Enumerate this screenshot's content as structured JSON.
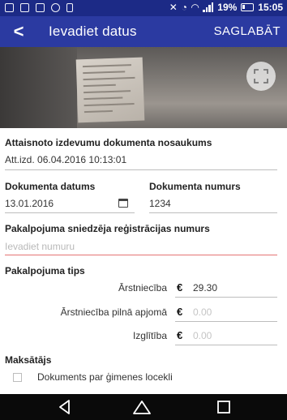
{
  "status_bar": {
    "battery_percent": "19%",
    "time": "15:05",
    "icons": [
      "notification-icon",
      "image-icon",
      "mail-icon",
      "call-icon",
      "lock-icon",
      "mute-icon",
      "alarm-icon",
      "wifi-icon",
      "signal-icon",
      "battery-icon"
    ]
  },
  "app_bar": {
    "title": "Ievadiet datus",
    "save_label": "SAGLABĀT",
    "back_icon": "back-arrow-icon",
    "color": "#2b3aa1"
  },
  "photo": {
    "expand_icon": "fullscreen-icon"
  },
  "form": {
    "doc_name": {
      "label": "Attaisnoto izdevumu dokumenta nosaukums",
      "value": "Att.izd. 06.04.2016 10:13:01"
    },
    "doc_date": {
      "label": "Dokumenta datums",
      "value": "13.01.2016",
      "icon": "calendar-icon"
    },
    "doc_number": {
      "label": "Dokumenta numurs",
      "value": "1234"
    },
    "provider_reg": {
      "label": "Pakalpojuma sniedzēja reģistrācijas numurs",
      "placeholder": "Ievadiet numuru"
    },
    "service_type": {
      "label": "Pakalpojuma tips",
      "currency": "€",
      "rows": [
        {
          "label": "Ārstniecība",
          "value": "29.30"
        },
        {
          "label": "Ārstniecība pilnā apjomā",
          "value": "0.00"
        },
        {
          "label": "Izglītība",
          "value": "0.00"
        }
      ]
    },
    "payer": {
      "label": "Maksātājs",
      "checkbox_label": "Dokuments par ģimenes locekli",
      "checked": false
    }
  },
  "nav_bar": {
    "icons": [
      "back-triangle-icon",
      "home-icon",
      "recents-icon"
    ]
  }
}
